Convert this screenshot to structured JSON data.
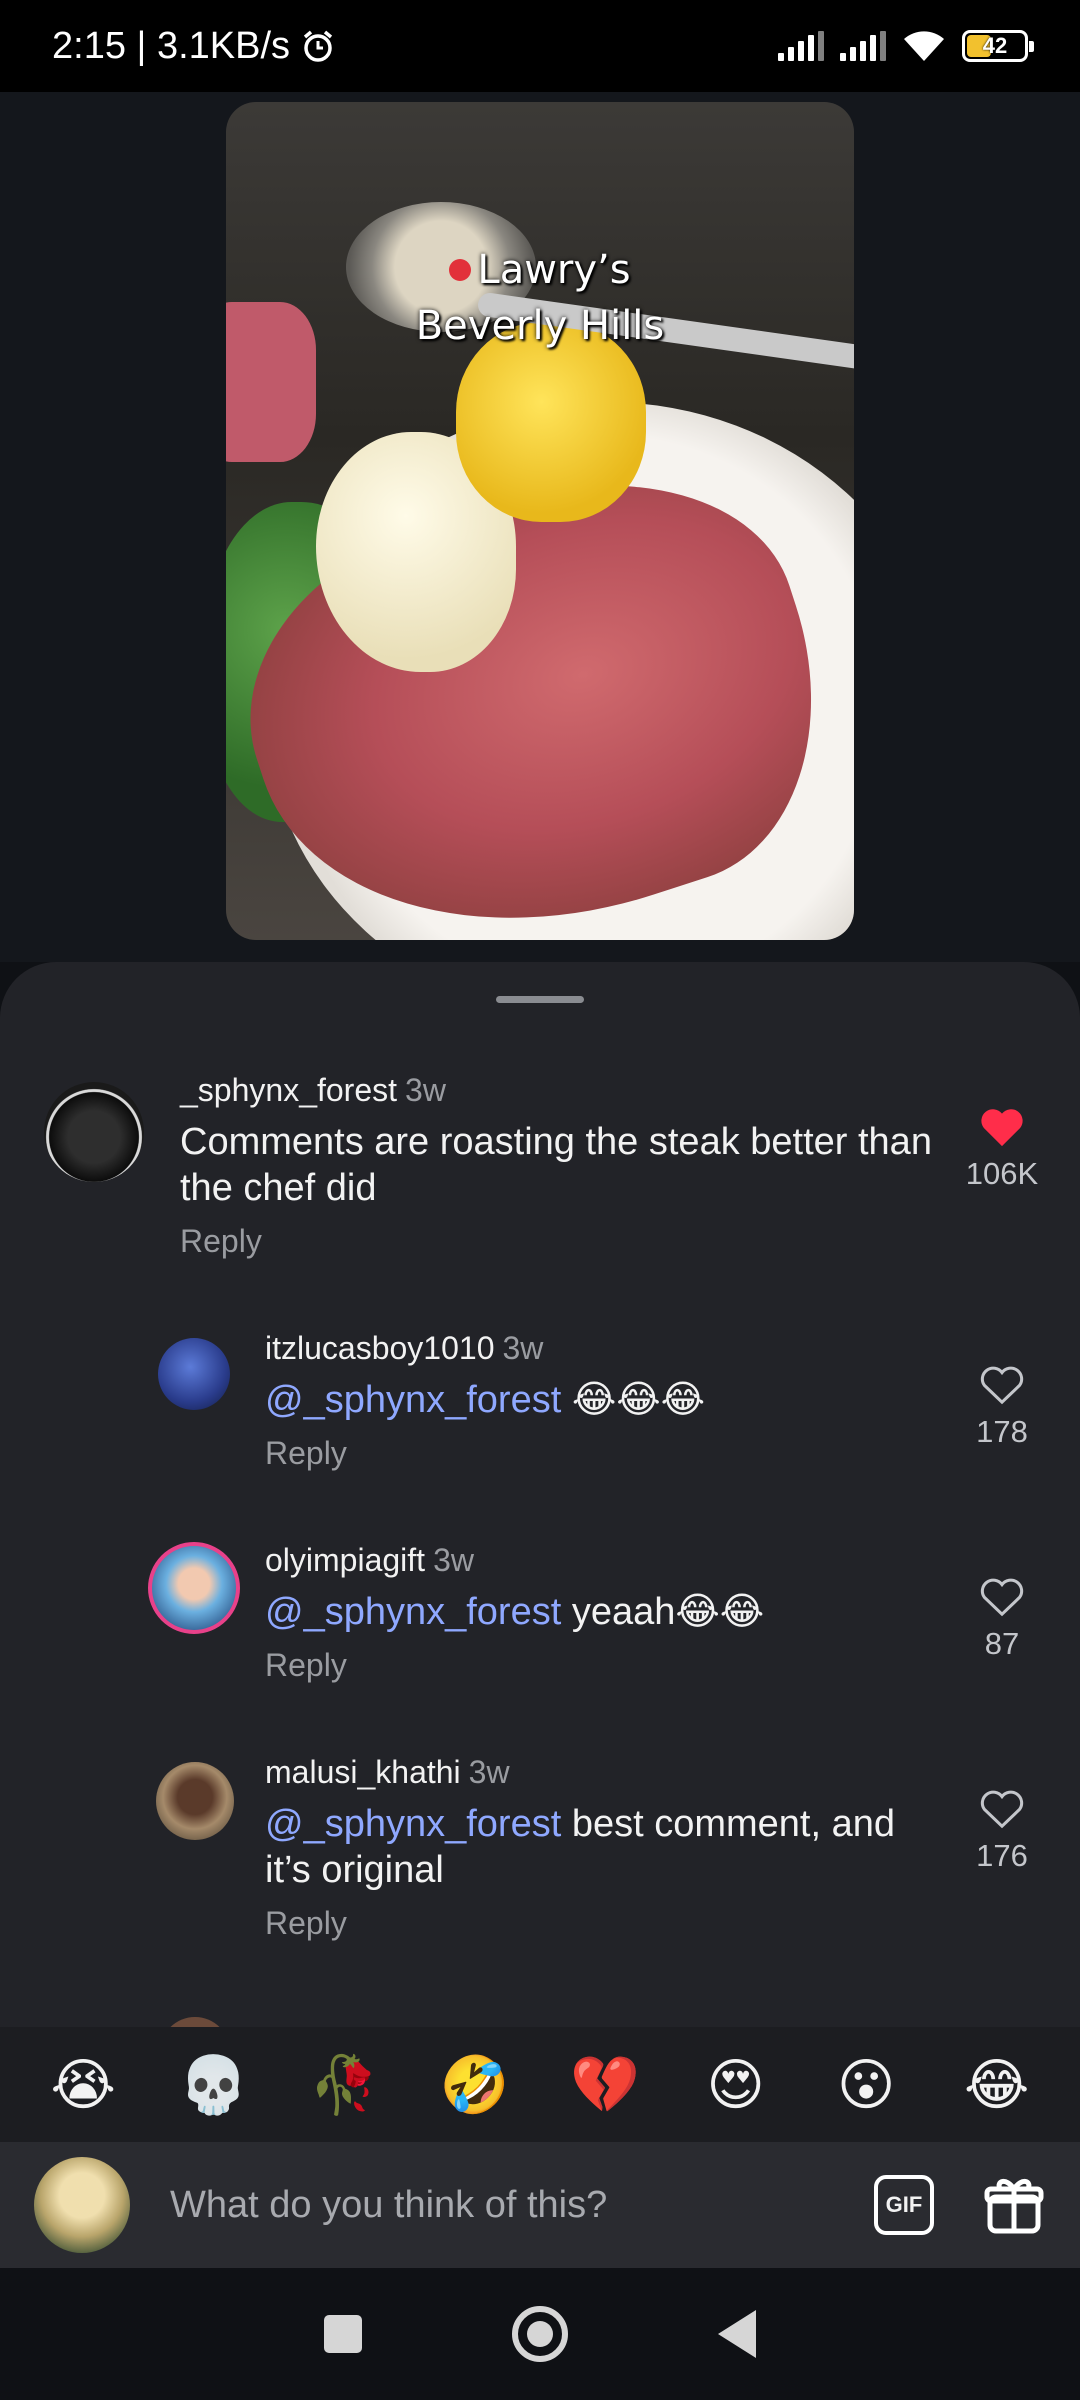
{
  "status_bar": {
    "time_speed": "2:15 | 3.1KB/s",
    "battery": "42"
  },
  "video": {
    "caption_line1": "Lawry’s",
    "caption_line2": "Beverly Hills"
  },
  "comments": [
    {
      "username": "_sphynx_forest",
      "time": "3w",
      "mention": "",
      "text": "Comments are roasting the steak better than the chef did",
      "reply_label": "Reply",
      "likes": "106K",
      "liked": true
    },
    {
      "username": "itzlucasboy1010",
      "time": "3w",
      "mention": "@_sphynx_forest",
      "text": "😂😂😂",
      "reply_label": "Reply",
      "likes": "178",
      "liked": false
    },
    {
      "username": "olyimpiagift",
      "time": "3w",
      "mention": "@_sphynx_forest",
      "text": "yeaah😂😂",
      "reply_label": "Reply",
      "likes": "87",
      "liked": false
    },
    {
      "username": "malusi_khathi",
      "time": "3w",
      "mention": "@_sphynx_forest",
      "text": "best comment, and it’s original",
      "reply_label": "Reply",
      "likes": "176",
      "liked": false
    }
  ],
  "emoji_bar": {
    "emojis": [
      "😭",
      "💀",
      "🥀",
      "🤣",
      "💔",
      "😍",
      "😮",
      "😂"
    ]
  },
  "input": {
    "placeholder": "What do you think of this?",
    "gif_label": "GIF"
  },
  "colors": {
    "sheet": "#222328",
    "mention": "#8fa8ff",
    "liked_heart": "#ff2d4a"
  }
}
